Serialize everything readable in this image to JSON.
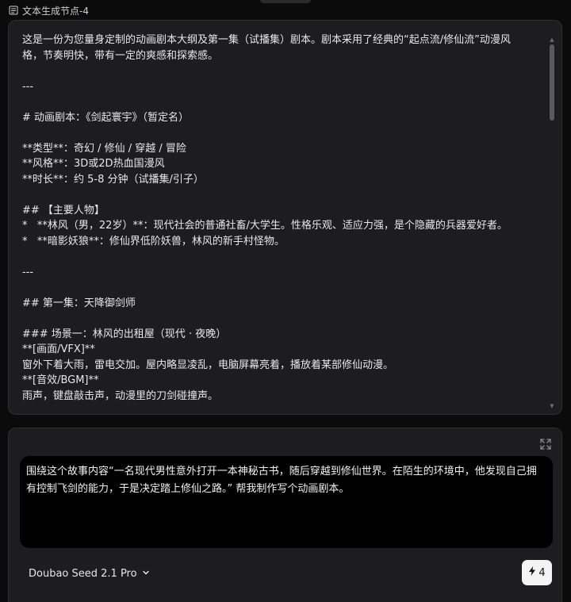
{
  "node": {
    "title": "文本生成节点-4",
    "icon": "document-icon"
  },
  "output": {
    "lines": [
      "这是一份为您量身定制的动画剧本大纲及第一集（试播集）剧本。剧本采用了经典的“起点流/修仙流”动漫风",
      "格，节奏明快，带有一定的爽感和探索感。",
      "",
      "---",
      "",
      "# 动画剧本：《剑起寰宇》（暂定名）",
      "",
      "**类型**：奇幻 / 修仙 / 穿越 / 冒险",
      "**风格**：3D或2D热血国漫风",
      "**时长**：约 5-8 分钟（试播集/引子）",
      "",
      "## 【主要人物】",
      "*   **林风（男，22岁）**：现代社会的普通社畜/大学生。性格乐观、适应力强，是个隐藏的兵器爱好者。",
      "*   **暗影妖狼**：修仙界低阶妖兽，林风的新手村怪物。",
      "",
      "---",
      "",
      "## 第一集：天降御剑师",
      "",
      "### 场景一：林风的出租屋（现代 · 夜晚）",
      "**[画面/VFX]**",
      "窗外下着大雨，雷电交加。屋内略显凌乱，电脑屏幕亮着，播放着某部修仙动漫。",
      "**[音效/BGM]**",
      "雨声，键盘敲击声，动漫里的刀剑碰撞声。"
    ]
  },
  "input": {
    "prompt": "围绕这个故事内容“一名现代男性意外打开一本神秘古书，随后穿越到修仙世界。在陌生的环境中，他发现自己拥有控制飞剑的能力，于是决定踏上修仙之路。” 帮我制作写个动画剧本。",
    "expand_icon": "expand-icon"
  },
  "model": {
    "selected": "Doubao Seed 2.1 Pro"
  },
  "run": {
    "cost": "4",
    "icon": "lightning-icon"
  }
}
